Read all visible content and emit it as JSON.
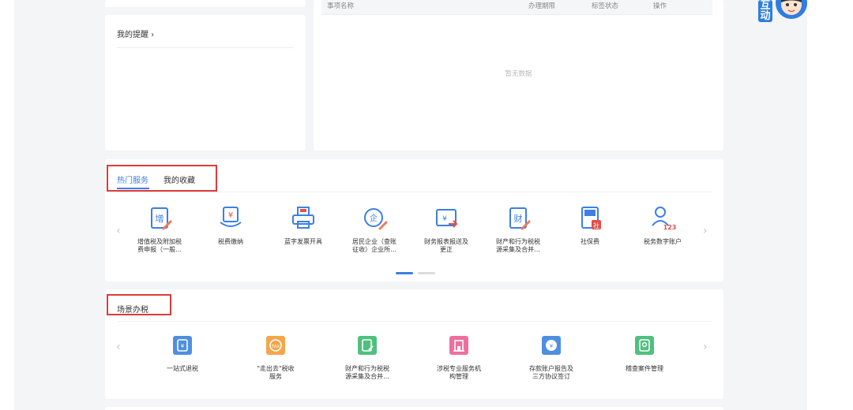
{
  "reminder": {
    "title": "我的提醒 ›"
  },
  "matters_table": {
    "headers": [
      "事项名称",
      "办理期限",
      "标签状态",
      "操作"
    ],
    "empty_text": "暂无数据"
  },
  "hot_section": {
    "tabs": [
      {
        "label": "热门服务",
        "active": true
      },
      {
        "label": "我的收藏",
        "active": false
      }
    ],
    "items": [
      {
        "icon": "vat-declaration-icon",
        "line1": "增值税及附加税",
        "line2": "费申报（一般..."
      },
      {
        "icon": "tax-payment-icon",
        "line1": "税费缴纳",
        "line2": ""
      },
      {
        "icon": "blue-invoice-printer-icon",
        "line1": "蓝字发票开具",
        "line2": ""
      },
      {
        "icon": "enterprise-tax-icon",
        "line1": "居民企业（查账",
        "line2": "征收）企业所..."
      },
      {
        "icon": "financial-report-icon",
        "line1": "财务报表报送及",
        "line2": "更正"
      },
      {
        "icon": "property-tax-icon",
        "line1": "财产和行为税税",
        "line2": "源采集及合并..."
      },
      {
        "icon": "social-insurance-icon",
        "line1": "社保费",
        "line2": ""
      },
      {
        "icon": "digital-account-icon",
        "line1": "税务数字账户",
        "line2": ""
      }
    ],
    "pagination": {
      "pages": 2,
      "active": 1
    }
  },
  "scene_section": {
    "title": "场景办税",
    "items": [
      {
        "icon": "one-stop-refund-icon",
        "color": "#4e8fe0",
        "line1": "一站式退税",
        "line2": ""
      },
      {
        "icon": "going-global-icon",
        "color": "#f4a64a",
        "line1": "\"走出去\"税收",
        "line2": "服务"
      },
      {
        "icon": "property-tax-collect-icon",
        "color": "#4fc07e",
        "line1": "财产和行为税税",
        "line2": "源采集及合并..."
      },
      {
        "icon": "tax-agency-icon",
        "color": "#ef6f9c",
        "line1": "涉税专业服务机",
        "line2": "构管理"
      },
      {
        "icon": "deposit-account-icon",
        "color": "#4e8fe0",
        "line1": "存款账户报告及",
        "line2": "三方协议签订"
      },
      {
        "icon": "inspection-case-icon",
        "color": "#4fc07e",
        "line1": "稽查案件管理",
        "line2": ""
      }
    ]
  },
  "assistant": {
    "label": "互动",
    "icon": "assistant-avatar-icon"
  },
  "colors": {
    "accent": "#3b7fe6",
    "highlight_box": "#e03a3a"
  }
}
